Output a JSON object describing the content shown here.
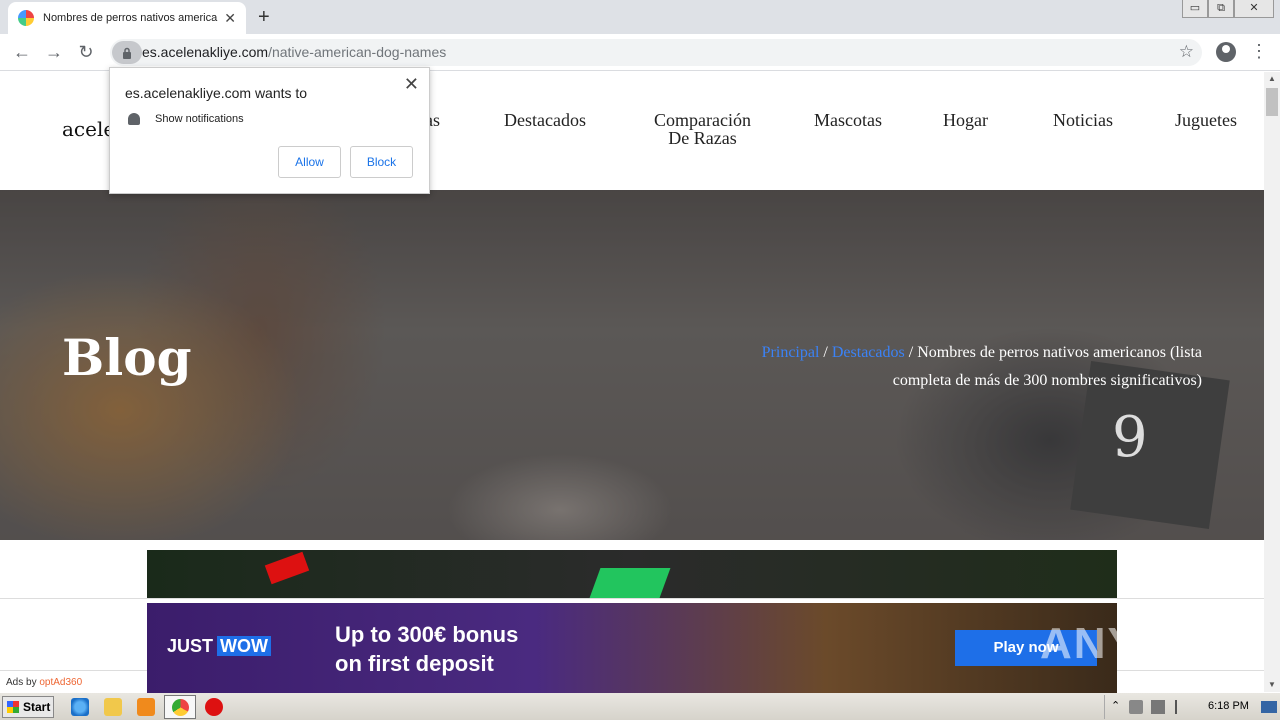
{
  "browser": {
    "tab_title": "Nombres de perros nativos americanos",
    "tab_close": "✕",
    "new_tab": "+",
    "url_host": "es.acelenakliye.com",
    "url_path": "/native-american-dog-names",
    "back": "←",
    "forward": "→",
    "reload": "↻",
    "bookmark": "☆",
    "menu": "⋮",
    "window_minimize": "▭",
    "window_restore": "⧉",
    "window_close": "✕"
  },
  "permission_popup": {
    "origin_text": "es.acelenakliye.com wants to",
    "request": "Show notifications",
    "allow_label": "Allow",
    "block_label": "Block",
    "close": "✕"
  },
  "site": {
    "logo_partial": "acele",
    "nav": [
      {
        "label": "as"
      },
      {
        "label": "Destacados"
      },
      {
        "label": "Comparación De Razas"
      },
      {
        "label": "Mascotas"
      },
      {
        "label": "Hogar"
      },
      {
        "label": "Noticias"
      },
      {
        "label": "Juguetes"
      }
    ],
    "hero_title": "Blog",
    "breadcrumb": {
      "home": "Principal",
      "sep1": " / ",
      "section": "Destacados",
      "sep2": " / ",
      "current": "Nombres de perros nativos americanos (lista completa de más de 300 nombres significativos)"
    },
    "hero_card_number": "9"
  },
  "ad": {
    "brand_just": "JUST",
    "brand_wow": "WOW",
    "headline_line1": "Up to 300€ bonus",
    "headline_line2": "on first deposit",
    "cta": "Play now",
    "ads_by": "Ads by",
    "ads_brand": "optAd360"
  },
  "watermark": "ANY RUN",
  "taskbar": {
    "start_label": "Start",
    "clock": "6:18 PM"
  },
  "colors": {
    "link_blue": "#3b82f6",
    "popup_button_text": "#1a73e8",
    "ad_cta": "#1e6fe8"
  }
}
